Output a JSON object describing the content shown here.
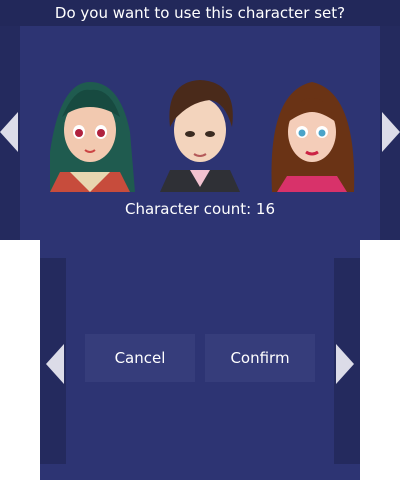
{
  "top": {
    "question": "Do you want to use this character set?",
    "character_count": "Character count: 16"
  },
  "icons": {
    "prev": "chevron-left-icon",
    "next": "chevron-right-icon"
  },
  "portraits": [
    {
      "name": "character-portrait-green-hair"
    },
    {
      "name": "character-portrait-brown-hair-male"
    },
    {
      "name": "character-portrait-brown-hair-female"
    }
  ],
  "buttons": {
    "cancel": "Cancel",
    "confirm": "Confirm"
  }
}
